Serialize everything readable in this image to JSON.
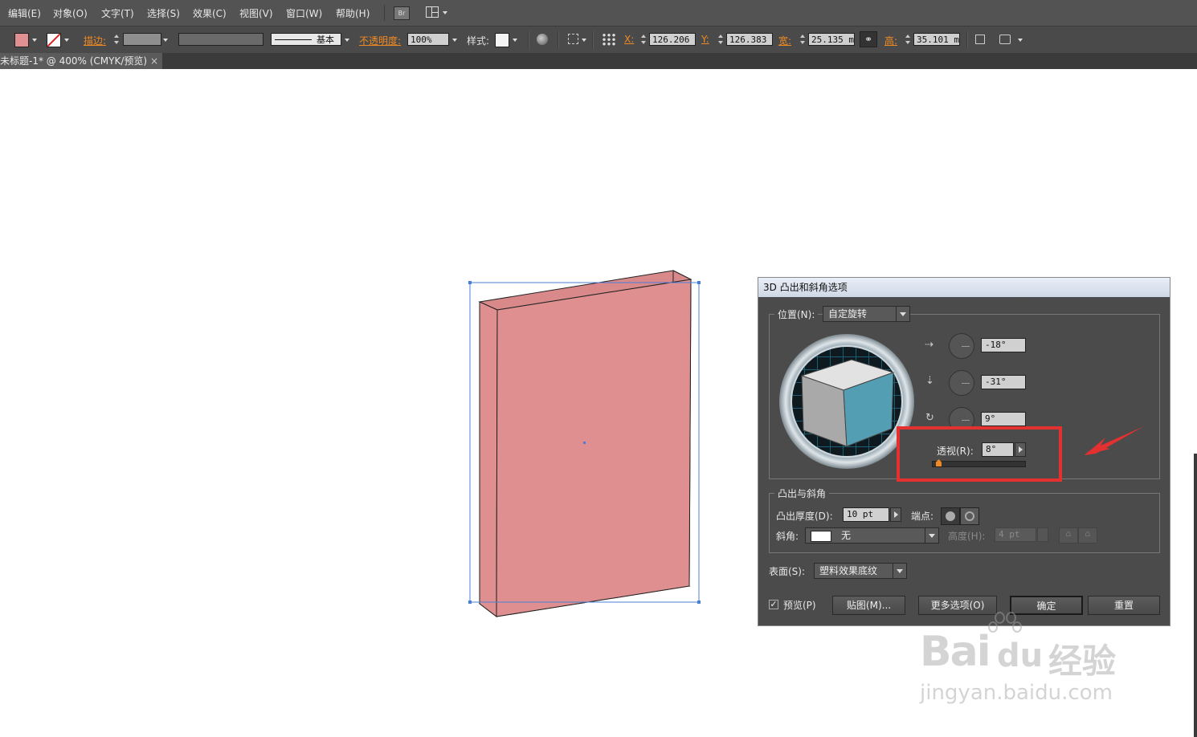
{
  "menu": [
    "编辑(E)",
    "对象(O)",
    "文字(T)",
    "选择(S)",
    "效果(C)",
    "视图(V)",
    "窗口(W)",
    "帮助(H)"
  ],
  "menu_icons": {
    "bridge": "Br"
  },
  "control": {
    "stroke_label": "描边:",
    "stroke_style": "基本",
    "opacity_label": "不透明度:",
    "opacity_value": "100%",
    "style_label": "样式:",
    "x_label": "X:",
    "x_value": "126.206 r",
    "y_label": "Y:",
    "y_value": "126.383 r",
    "w_label": "宽:",
    "w_value": "25.135 mi",
    "h_label": "高:",
    "h_value": "35.101 mi",
    "fill_color": "#e09090"
  },
  "tab": {
    "title": "未标题-1* @ 400% (CMYK/预览)",
    "close": "×"
  },
  "canvas": {
    "shape_color": "#df8f8f",
    "selection_color": "#4a7fd6"
  },
  "dialog": {
    "title": "3D 凸出和斜角选项",
    "position_label": "位置(N):",
    "position_value": "自定旋转",
    "rot_x": "-18°",
    "rot_y": "-31°",
    "rot_z": "9°",
    "perspective_label": "透视(R):",
    "perspective_value": "8°",
    "extrude_group": "凸出与斜角",
    "depth_label": "凸出厚度(D):",
    "depth_value": "10 pt",
    "cap_label": "端点:",
    "bevel_label": "斜角:",
    "bevel_value": "无",
    "height_label": "高度(H):",
    "height_value": "4 pt",
    "surface_label": "表面(S):",
    "surface_value": "塑料效果底纹",
    "preview_label": "预览(P)",
    "map_button": "贴图(M)...",
    "more_button": "更多选项(O)",
    "ok_button": "确定",
    "reset_button": "重置"
  },
  "watermark": {
    "brand": "Bai",
    "brand2": "du",
    "brand_cn": "经验",
    "url": "jingyan.baidu.com"
  },
  "highlight_color": "#e53030"
}
